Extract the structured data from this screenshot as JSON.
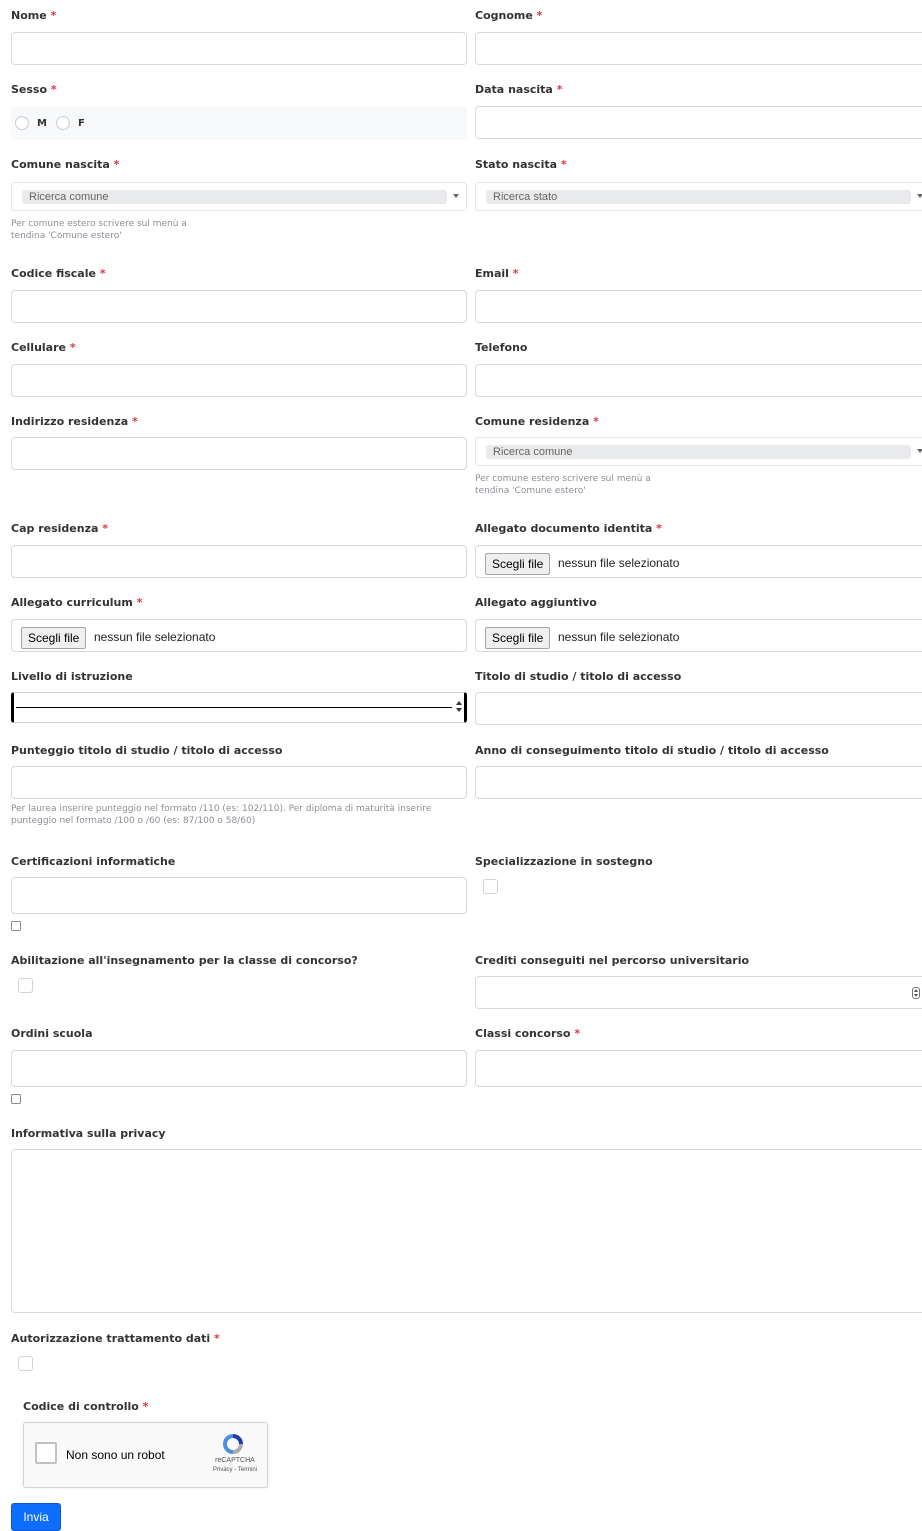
{
  "required_mark": "*",
  "fields": {
    "nome": "Nome",
    "cognome": "Cognome",
    "sesso": "Sesso",
    "data_nascita": "Data nascita",
    "comune_nascita": "Comune nascita",
    "stato_nascita": "Stato nascita",
    "codice_fiscale": "Codice fiscale",
    "email": "Email",
    "cellulare": "Cellulare",
    "telefono": "Telefono",
    "indirizzo_residenza": "Indirizzo residenza",
    "comune_residenza": "Comune residenza",
    "cap_residenza": "Cap residenza",
    "allegato_documento": "Allegato documento identita",
    "allegato_curriculum": "Allegato curriculum",
    "allegato_aggiuntivo": "Allegato aggiuntivo",
    "livello_istruzione": "Livello di istruzione",
    "titolo_studio": "Titolo di studio / titolo di accesso",
    "punteggio_titolo": "Punteggio titolo di studio / titolo di accesso",
    "anno_conseguimento": "Anno di conseguimento titolo di studio / titolo di accesso",
    "certificazioni": "Certificazioni informatiche",
    "specializzazione": "Specializzazione in sostegno",
    "abilitazione": "Abilitazione all'insegnamento per la classe di concorso?",
    "crediti": "Crediti conseguiti nel percorso universitario",
    "ordini_scuola": "Ordini scuola",
    "classi_concorso": "Classi concorso",
    "informativa_privacy": "Informativa sulla privacy",
    "autorizzazione": "Autorizzazione trattamento dati",
    "codice_controllo": "Codice di controllo"
  },
  "sesso_options": {
    "m": "M",
    "f": "F"
  },
  "placeholders": {
    "ricerca_comune": "Ricerca comune",
    "ricerca_stato": "Ricerca stato"
  },
  "help": {
    "comune_estero_1": "Per comune estero scrivere sul menù a",
    "comune_estero_2": "tendina 'Comune estero'",
    "punteggio_1": "Per laurea inserire punteggio nel formato /110 (es: 102/110). Per diploma di maturità inserire",
    "punteggio_2": "punteggio nel formato /100 o /60 (es: 87/100 o 58/60)"
  },
  "file_input": {
    "button": "Scegli file",
    "no_file": "nessun file selezionato"
  },
  "recaptcha": {
    "label": "Non sono un robot",
    "brand": "reCAPTCHA",
    "links": "Privacy - Termini"
  },
  "submit": "Invia",
  "colors": {
    "required": "#dc3545",
    "submit_bg": "#0d6efd",
    "recaptcha_blue": "#1c3aa9",
    "recaptcha_lightblue": "#4a90e2"
  }
}
